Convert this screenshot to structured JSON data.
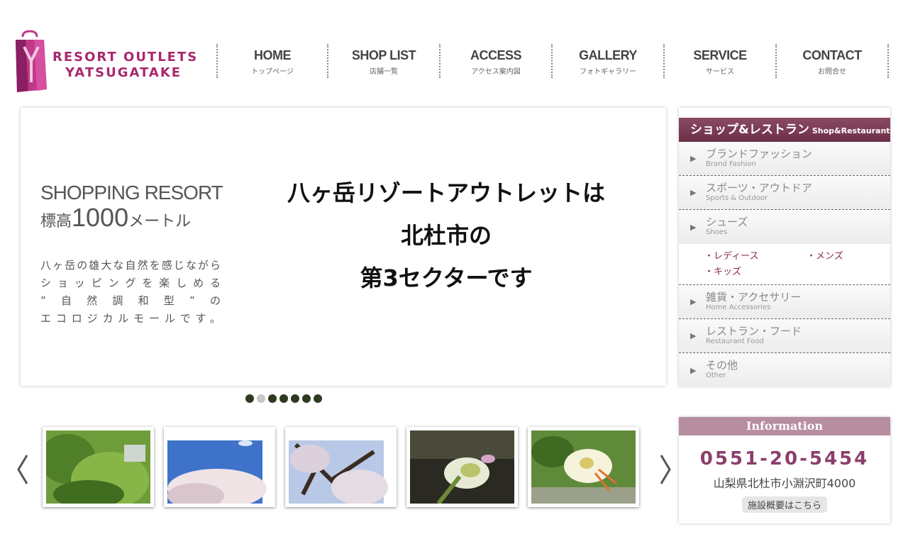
{
  "brand": {
    "line1": "RESORT OUTLETS",
    "line2": "YATSUGATAKE",
    "color": "#a8286e"
  },
  "nav": [
    {
      "en": "HOME",
      "jp": "トップページ"
    },
    {
      "en": "SHOP LIST",
      "jp": "店舗一覧"
    },
    {
      "en": "ACCESS",
      "jp": "アクセス案内図"
    },
    {
      "en": "GALLERY",
      "jp": "フォトギャラリー"
    },
    {
      "en": "SERVICE",
      "jp": "サービス"
    },
    {
      "en": "CONTACT",
      "jp": "お問合せ"
    }
  ],
  "hero": {
    "tagline1": "SHOPPING RESORT",
    "tagline2_prefix": "標高",
    "tagline2_num": "1000",
    "tagline2_suffix": "メートル",
    "desc": [
      "八ヶ岳の雄大な自然を感じながら",
      "ショッピングを楽しめる",
      "”自然調和型”の",
      "エコロジカルモールです。"
    ],
    "main": [
      "八ヶ岳リゾートアウトレットは",
      "北杜市の",
      "第3セクターです"
    ]
  },
  "slider": {
    "dot_count": 7,
    "active_index": 1
  },
  "gallery": {
    "prev_icon": "chevron-left-icon",
    "next_icon": "chevron-right-icon",
    "thumbs": [
      "green-trees-photo",
      "cherry-blossom-sky-photo",
      "cherry-blossom-branches-photo",
      "amaryllis-flower-photo",
      "spotted-lily-photo"
    ]
  },
  "sidebar": {
    "title": "ショップ&レストラン",
    "title_en": "Shop&Restaurants",
    "categories": [
      {
        "jp": "ブランドファッション",
        "en": "Brand Fashion"
      },
      {
        "jp": "スポーツ・アウトドア",
        "en": "Sports & Outdoor"
      },
      {
        "jp": "シューズ",
        "en": "Shoes"
      },
      {
        "jp": "雑貨・アクセサリー",
        "en": "Home Accessories"
      },
      {
        "jp": "レストラン・フード",
        "en": "Restaurant Food"
      },
      {
        "jp": "その他",
        "en": "Other"
      }
    ],
    "shoe_links": [
      "・レディース",
      "・メンズ",
      "・キッズ"
    ]
  },
  "info": {
    "title": "Information",
    "phone": "0551-20-5454",
    "address": "山梨県北杜市小淵沢町4000",
    "link": "施設概要はこちら"
  }
}
